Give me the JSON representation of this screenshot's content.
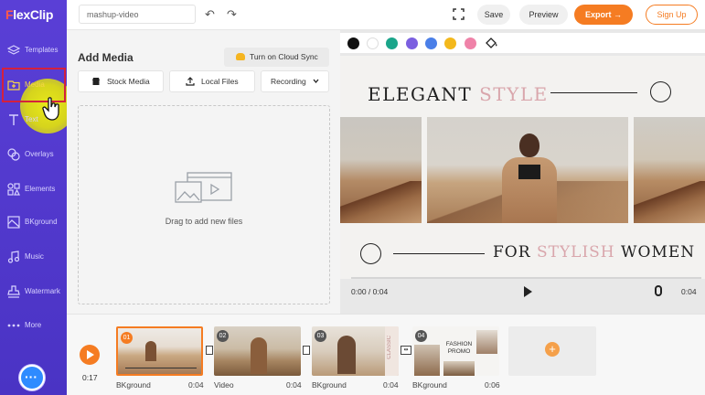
{
  "app": {
    "logo_text": "FlexClip",
    "project_name": "mashup-video"
  },
  "sidebar": {
    "items": [
      {
        "label": "Templates",
        "icon": "layers-icon"
      },
      {
        "label": "Media",
        "icon": "media-folder-icon",
        "active": true
      },
      {
        "label": "Text",
        "icon": "text-icon"
      },
      {
        "label": "Overlays",
        "icon": "overlays-icon"
      },
      {
        "label": "Elements",
        "icon": "elements-icon"
      },
      {
        "label": "BKground",
        "icon": "background-icon"
      },
      {
        "label": "Music",
        "icon": "music-icon"
      },
      {
        "label": "Watermark",
        "icon": "watermark-icon"
      },
      {
        "label": "More",
        "icon": "more-dots-icon"
      }
    ]
  },
  "toolbar": {
    "save": "Save",
    "preview": "Preview",
    "export": "Export",
    "export_arrow": "→",
    "signup": "Sign Up"
  },
  "media_panel": {
    "title": "Add Media",
    "cloud_sync": "Turn on Cloud Sync",
    "tabs": {
      "stock": "Stock Media",
      "local": "Local Files",
      "recording": "Recording"
    },
    "dropzone_label": "Drag to add new files"
  },
  "colors": {
    "accent": "#f57c22",
    "sidebar": "#5a3fd6",
    "palette": [
      "#111111",
      "#ffffff",
      "#1aa58a",
      "#7b5fe0",
      "#4a7fe8",
      "#f3b81c",
      "#ef82a8"
    ]
  },
  "canvas": {
    "title_a": "ELEGANT",
    "title_b": "STYLE",
    "sub_a": "FOR",
    "sub_b": "STYLISH",
    "sub_c": "WOMEN",
    "time_start": "0:00 / 0:04",
    "time_end": "0:04"
  },
  "timeline": {
    "total": "0:17",
    "clips": [
      {
        "num": "01",
        "label": "BKground",
        "duration": "0:04"
      },
      {
        "num": "02",
        "label": "Video",
        "duration": "0:04"
      },
      {
        "num": "03",
        "label": "BKground",
        "duration": "0:04"
      },
      {
        "num": "04",
        "label": "BKground",
        "duration": "0:06"
      }
    ],
    "clip4_caption_a": "FASHION",
    "clip4_caption_b": "PROMO",
    "clip3_side_text": "CLASSIC",
    "add_label": "+"
  }
}
